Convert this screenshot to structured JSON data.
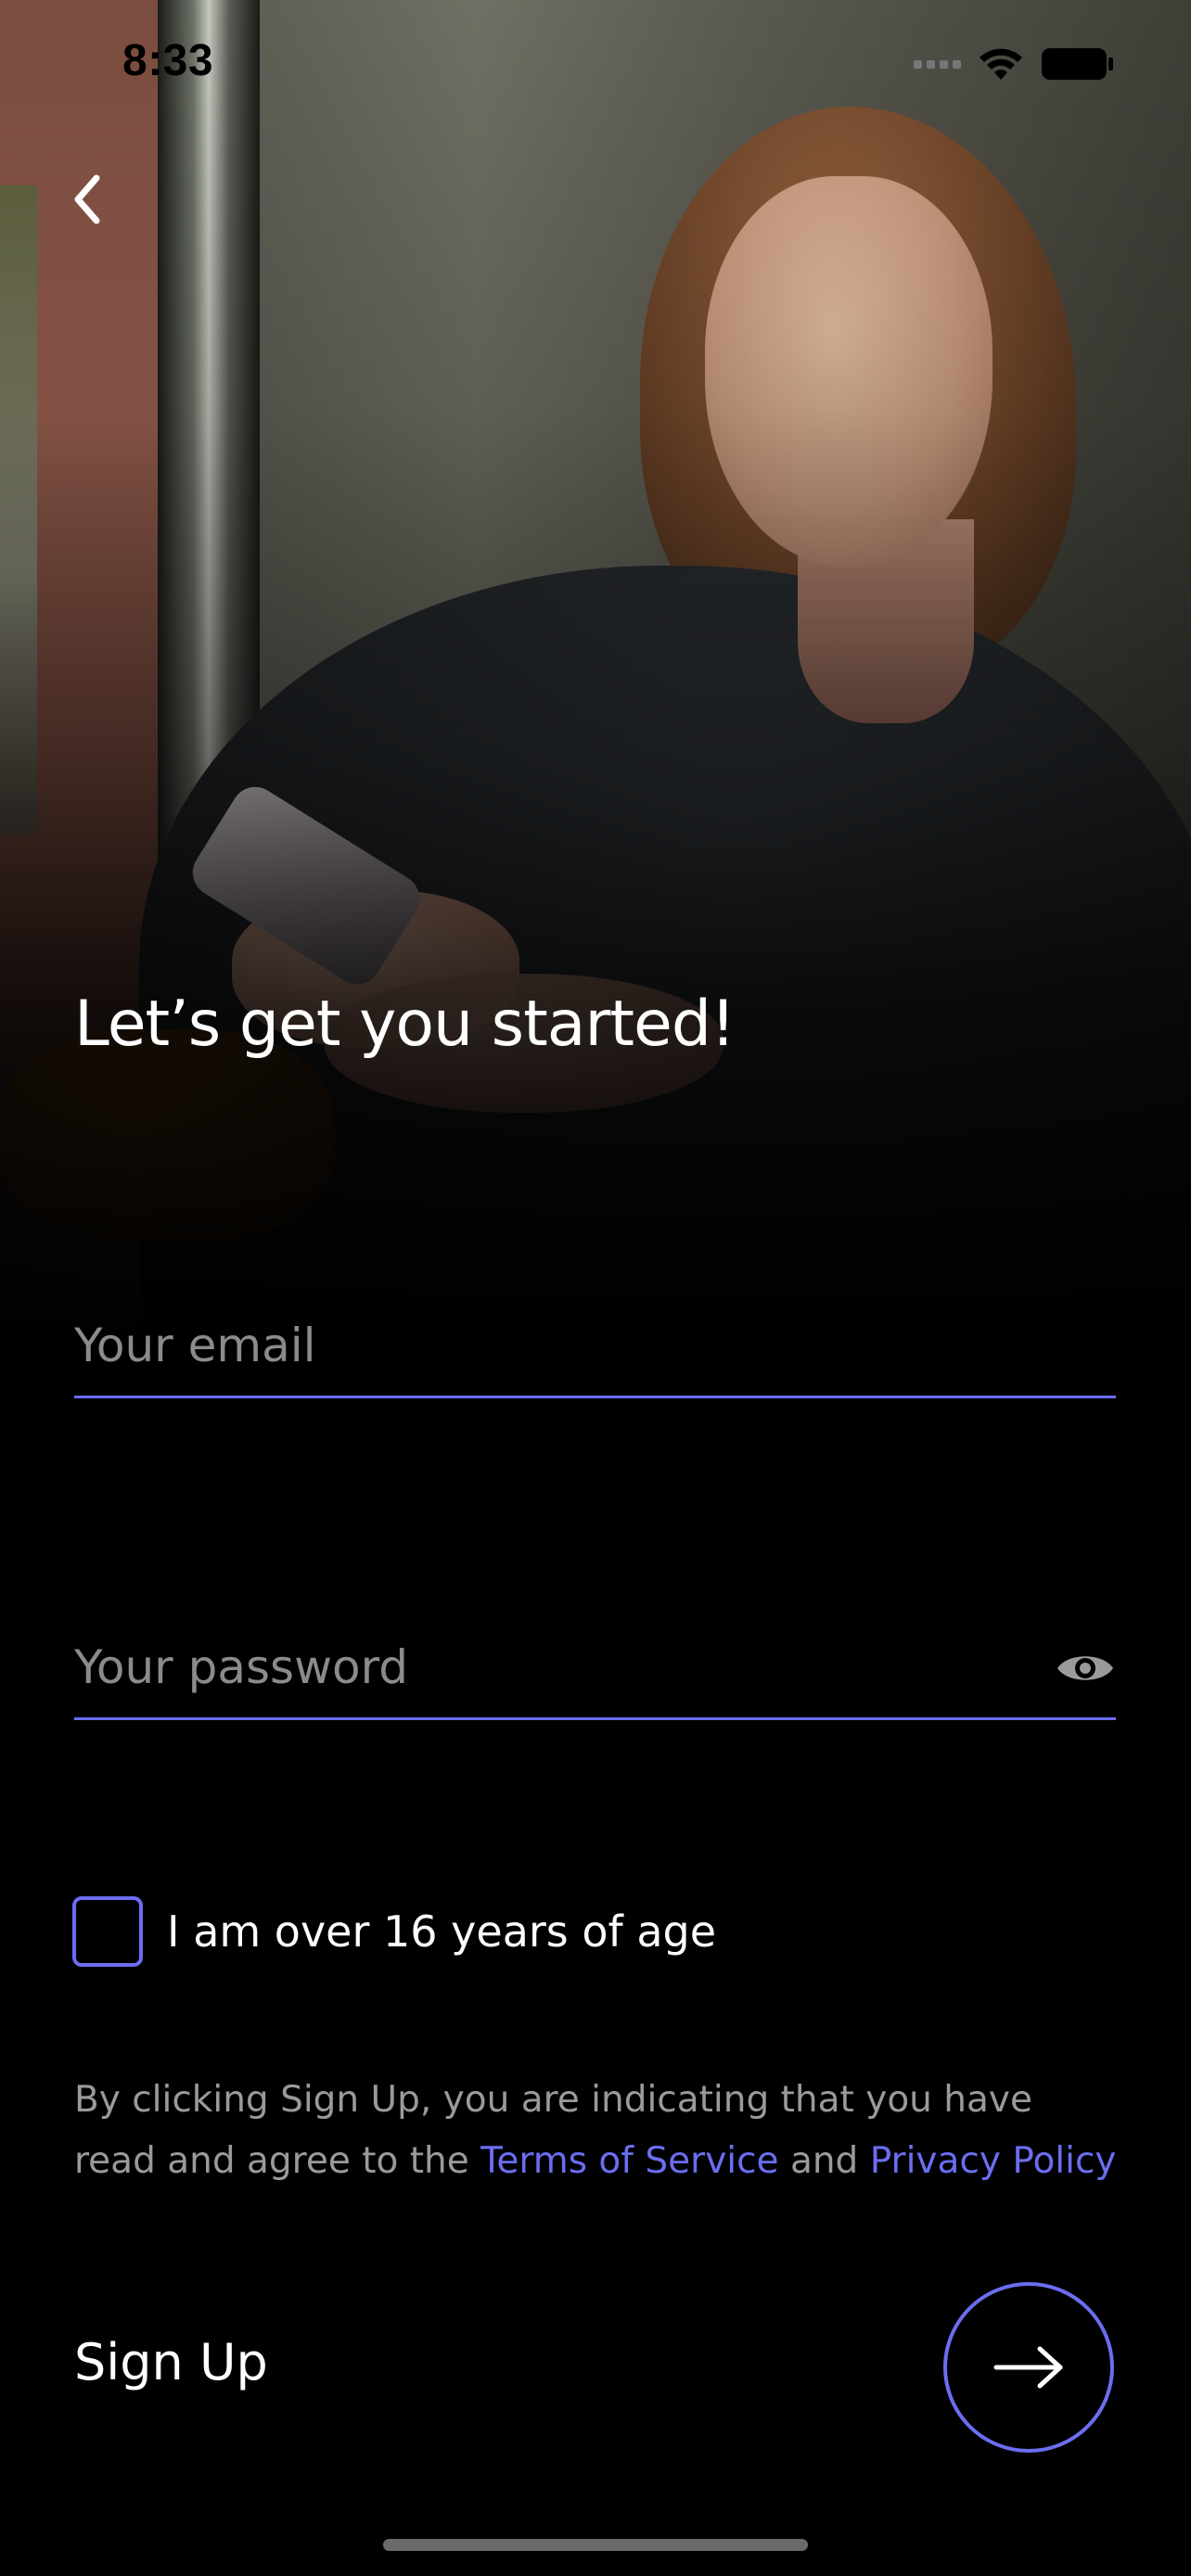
{
  "status_bar": {
    "time": "8:33"
  },
  "header": {
    "back_icon": "chevron-left-icon"
  },
  "main": {
    "title": "Let’s get you started!",
    "email": {
      "placeholder": "Your email",
      "value": ""
    },
    "password": {
      "placeholder": "Your password",
      "value": "",
      "visibility_icon": "eye-icon"
    },
    "age_checkbox": {
      "label": "I am over 16 years of age",
      "checked": false
    },
    "legal": {
      "text_before": "By clicking Sign Up, you are indicating that you have read and agree to the ",
      "terms_link": "Terms of Service",
      "text_between": " and ",
      "privacy_link": "Privacy Policy"
    },
    "signup": {
      "label": "Sign Up",
      "button_icon": "arrow-right-icon"
    }
  },
  "colors": {
    "accent": "#6b6ef0",
    "background": "#000000",
    "muted_text": "#9a9a9a",
    "placeholder": "#8b8b8b"
  }
}
